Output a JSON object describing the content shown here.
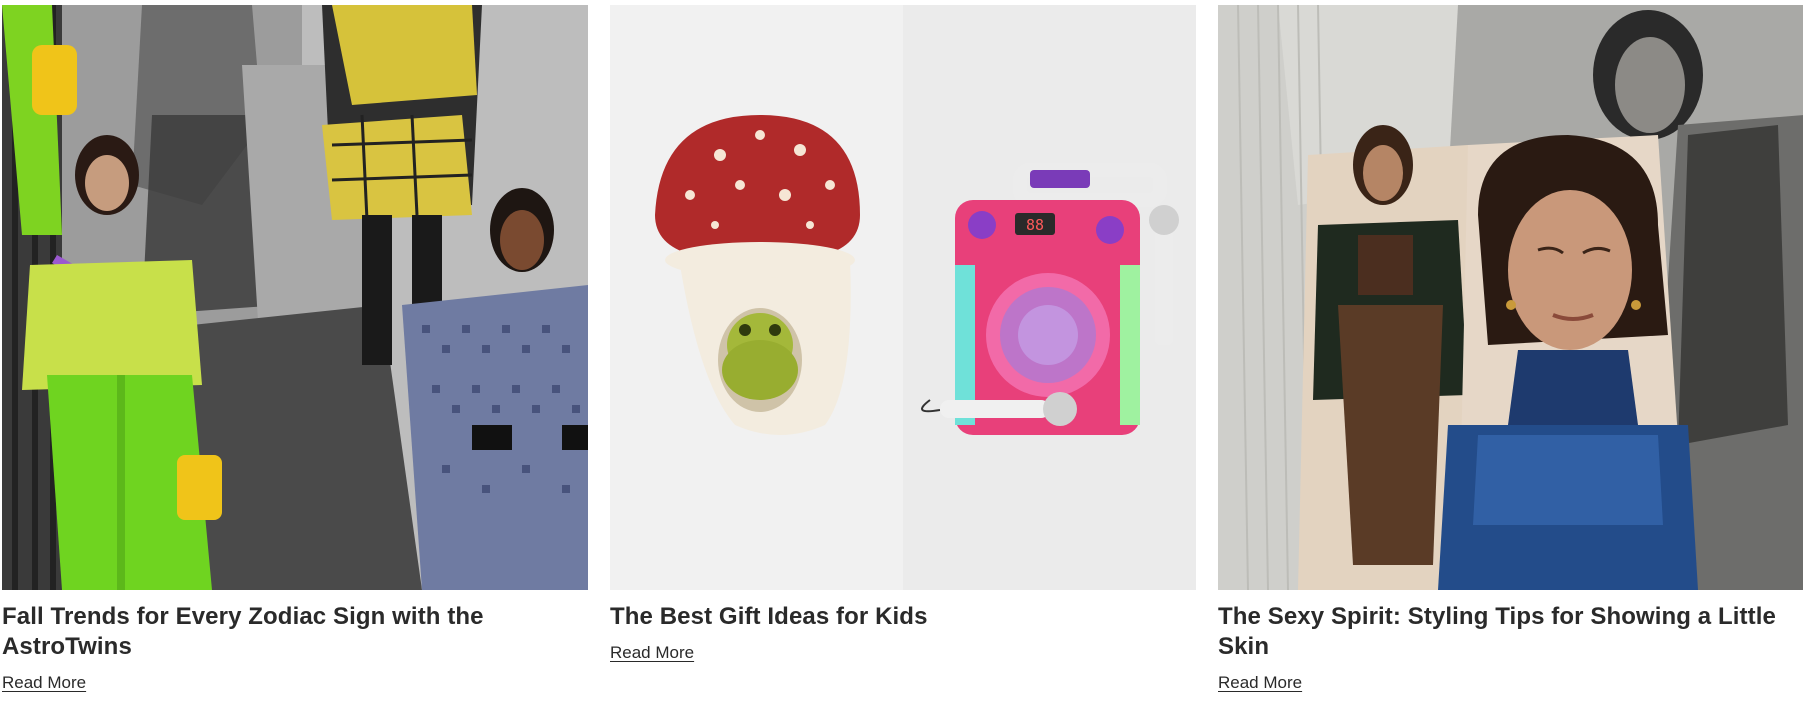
{
  "articles": [
    {
      "title": "Fall Trends for Every Zodiac Sign with the AstroTwins",
      "link_label": "Read More",
      "image": "fashion-collage-zodiac"
    },
    {
      "title": "The Best Gift Ideas for Kids",
      "link_label": "Read More",
      "image": "kids-gifts-mushroom-plush-karaoke"
    },
    {
      "title": "The Sexy Spirit: Styling Tips for Showing a Little Skin",
      "link_label": "Read More",
      "image": "fashion-collage-sheer-knit"
    }
  ],
  "colors": {
    "text": "#2a2a2a",
    "background": "#ffffff",
    "accent_green": "#7ed321",
    "accent_pink": "#e8407a",
    "mushroom_red": "#b02a2a"
  },
  "karaoke_display": "88"
}
